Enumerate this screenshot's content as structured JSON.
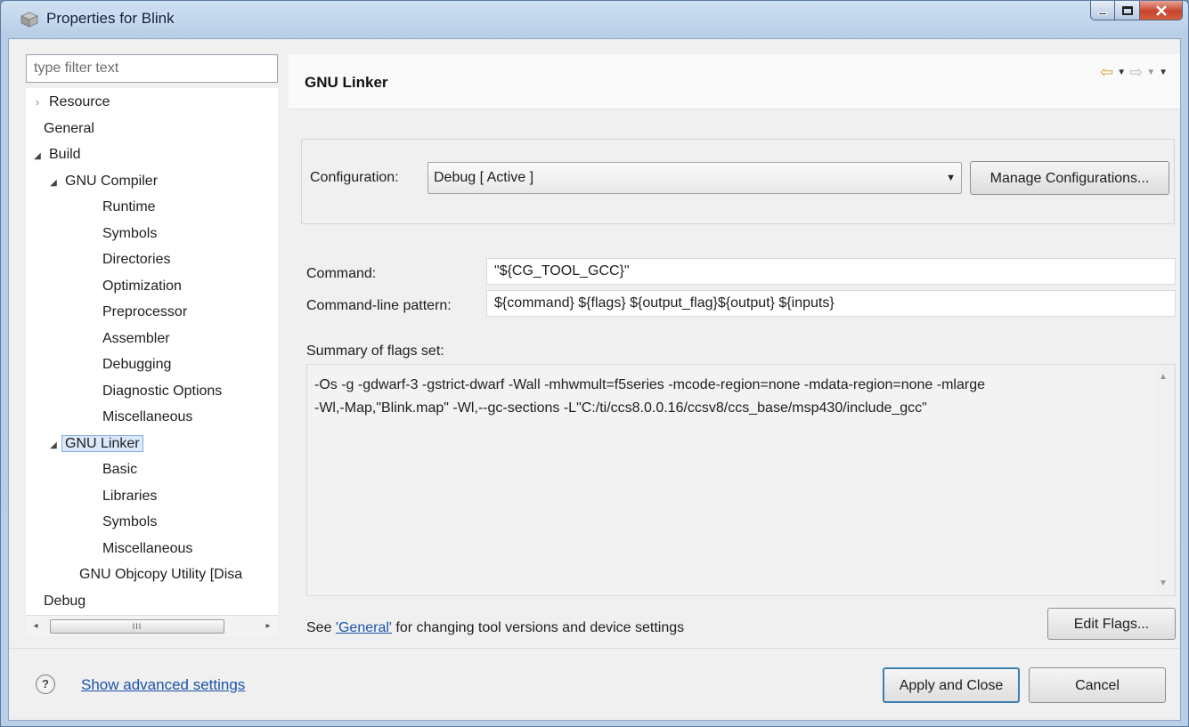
{
  "window": {
    "title": "Properties for Blink"
  },
  "left": {
    "filter_placeholder": "type filter text",
    "tree": [
      {
        "label": "Resource",
        "level": 0,
        "twisty": "closed"
      },
      {
        "label": "General",
        "level": 0,
        "twisty": "none"
      },
      {
        "label": "Build",
        "level": 0,
        "twisty": "open"
      },
      {
        "label": "GNU Compiler",
        "level": 1,
        "twisty": "open"
      },
      {
        "label": "Runtime",
        "level": 2,
        "twisty": "none"
      },
      {
        "label": "Symbols",
        "level": 2,
        "twisty": "none"
      },
      {
        "label": "Directories",
        "level": 2,
        "twisty": "none"
      },
      {
        "label": "Optimization",
        "level": 2,
        "twisty": "none"
      },
      {
        "label": "Preprocessor",
        "level": 2,
        "twisty": "none"
      },
      {
        "label": "Assembler",
        "level": 2,
        "twisty": "none"
      },
      {
        "label": "Debugging",
        "level": 2,
        "twisty": "none"
      },
      {
        "label": "Diagnostic Options",
        "level": 2,
        "twisty": "none"
      },
      {
        "label": "Miscellaneous",
        "level": 2,
        "twisty": "none"
      },
      {
        "label": "GNU Linker",
        "level": 1,
        "twisty": "open",
        "selected": true
      },
      {
        "label": "Basic",
        "level": 2,
        "twisty": "none"
      },
      {
        "label": "Libraries",
        "level": 2,
        "twisty": "none"
      },
      {
        "label": "Symbols",
        "level": 2,
        "twisty": "none"
      },
      {
        "label": "Miscellaneous",
        "level": 2,
        "twisty": "none"
      },
      {
        "label": "GNU Objcopy Utility  [Disa",
        "level": 1,
        "twisty": "none"
      },
      {
        "label": "Debug",
        "level": 0,
        "twisty": "none"
      }
    ],
    "scroll_thumb_grip": "III"
  },
  "footer": {
    "help_glyph": "?",
    "advanced_link": "Show advanced settings",
    "apply_label": "Apply and Close",
    "cancel_label": "Cancel"
  },
  "page": {
    "title": "GNU Linker",
    "config_label": "Configuration:",
    "config_value": "Debug  [ Active ]",
    "manage_label": "Manage Configurations...",
    "command_label": "Command:",
    "command_value": "\"${CG_TOOL_GCC}\"",
    "pattern_label": "Command-line pattern:",
    "pattern_value": "${command} ${flags} ${output_flag}${output} ${inputs}",
    "summary_label": "Summary of flags set:",
    "summary_value": "-Os -g -gdwarf-3 -gstrict-dwarf -Wall -mhwmult=f5series -mcode-region=none -mdata-region=none -mlarge\n-Wl,-Map,\"Blink.map\" -Wl,--gc-sections -L\"C:/ti/ccs8.0.0.16/ccsv8/ccs_base/msp430/include_gcc\"",
    "edit_flags_label": "Edit Flags...",
    "see_prefix": "See ",
    "see_link": "'General'",
    "see_suffix": " for changing tool versions and device settings"
  },
  "colors": {
    "link": "#1b54ab",
    "selection_bg": "#d9e8fb",
    "selection_border": "#84acdd"
  }
}
